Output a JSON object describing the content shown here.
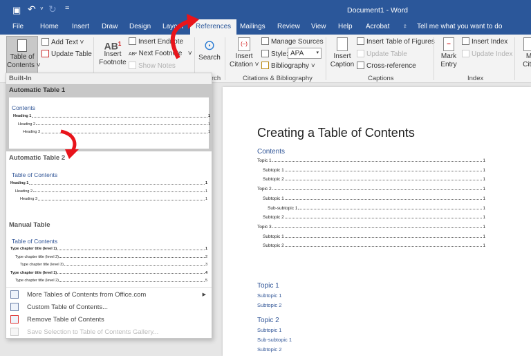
{
  "window": {
    "title": "Document1  -  Word"
  },
  "qat": {
    "save": "save-icon",
    "undo": "undo-icon",
    "redo": "redo-icon",
    "customize": "="
  },
  "tabs": [
    "File",
    "Home",
    "Insert",
    "Draw",
    "Design",
    "Layout",
    "References",
    "Mailings",
    "Review",
    "View",
    "Help",
    "Acrobat"
  ],
  "active_tab": "References",
  "tell_me": "Tell me what you want to do",
  "ribbon": {
    "toc": {
      "big": "Table of Contents",
      "big1": "Table of",
      "big2": "Contents",
      "add_text": "Add Text",
      "update_table": "Update Table"
    },
    "footnotes": {
      "insert_footnote1": "Insert",
      "insert_footnote2": "Footnote",
      "insert_endnote": "Insert Endnote",
      "next_footnote": "Next Footnote",
      "show_notes": "Show Notes"
    },
    "research": {
      "search": "Search",
      "label": "rch"
    },
    "citations": {
      "insert_citation1": "Insert",
      "insert_citation2": "Citation",
      "manage_sources": "Manage Sources",
      "style_label": "Style:",
      "style_value": "APA",
      "bibliography": "Bibliography",
      "label": "Citations & Bibliography"
    },
    "captions": {
      "insert_caption1": "Insert",
      "insert_caption2": "Caption",
      "insert_tof": "Insert Table of Figures",
      "update_table": "Update Table",
      "cross_ref": "Cross-reference",
      "label": "Captions"
    },
    "index": {
      "mark_entry1": "Mark",
      "mark_entry2": "Entry",
      "insert_index": "Insert Index",
      "update_index": "Update Index",
      "label": "Index"
    },
    "toa": {
      "mark1": "M",
      "mark2": "Cita"
    }
  },
  "dropdown": {
    "builtin": "Built-In",
    "auto1": {
      "title": "Automatic Table 1",
      "heading": "Contents",
      "lines": [
        {
          "t": "Heading 1",
          "p": "1"
        },
        {
          "t": "Heading 2",
          "p": "1"
        },
        {
          "t": "Heading 3",
          "p": "1"
        }
      ]
    },
    "auto2": {
      "title": "Automatic Table 2",
      "heading": "Table of Contents",
      "lines": [
        {
          "t": "Heading 1",
          "p": "1"
        },
        {
          "t": "Heading 2",
          "p": "1"
        },
        {
          "t": "Heading 3",
          "p": "1"
        }
      ]
    },
    "manual": {
      "title": "Manual Table",
      "heading": "Table of Contents",
      "lines": [
        {
          "t": "Type chapter title (level 1)",
          "p": "1"
        },
        {
          "t": "Type chapter title (level 2)",
          "p": "2"
        },
        {
          "t": "Type chapter title (level 3)",
          "p": "3"
        },
        {
          "t": "Type chapter title (level 1)",
          "p": "4"
        },
        {
          "t": "Type chapter title (level 2)",
          "p": "5"
        }
      ]
    },
    "menu": [
      "More Tables of Contents from Office.com",
      "Custom Table of Contents...",
      "Remove Table of Contents",
      "Save Selection to Table of Contents Gallery..."
    ]
  },
  "document": {
    "title": "Creating a Table of Contents",
    "toc_heading": "Contents",
    "toc": [
      {
        "t": "Topic 1",
        "p": "1"
      },
      {
        "t": "Subtopic 1",
        "p": "1"
      },
      {
        "t": "Subtopic 2",
        "p": "1"
      },
      {
        "t": "Topic 2",
        "p": "1"
      },
      {
        "t": "Subtopic 1",
        "p": "1"
      },
      {
        "t": "Sub-subtopic 1",
        "p": "1"
      },
      {
        "t": "Subtopic 2",
        "p": "1"
      },
      {
        "t": "Topic 3",
        "p": "1"
      },
      {
        "t": "Subtopic 1",
        "p": "1"
      },
      {
        "t": "Subtopic 2",
        "p": "1"
      }
    ],
    "body": [
      "Topic 1",
      "Subtopic 1",
      "Subtopic 2",
      "Topic 2",
      "Subtopic 1",
      "Sub-subtopic 1",
      "Subtopic 2"
    ]
  },
  "colors": {
    "brand": "#2b579a",
    "heading": "#2f5496",
    "arrow": "#e8141b"
  }
}
